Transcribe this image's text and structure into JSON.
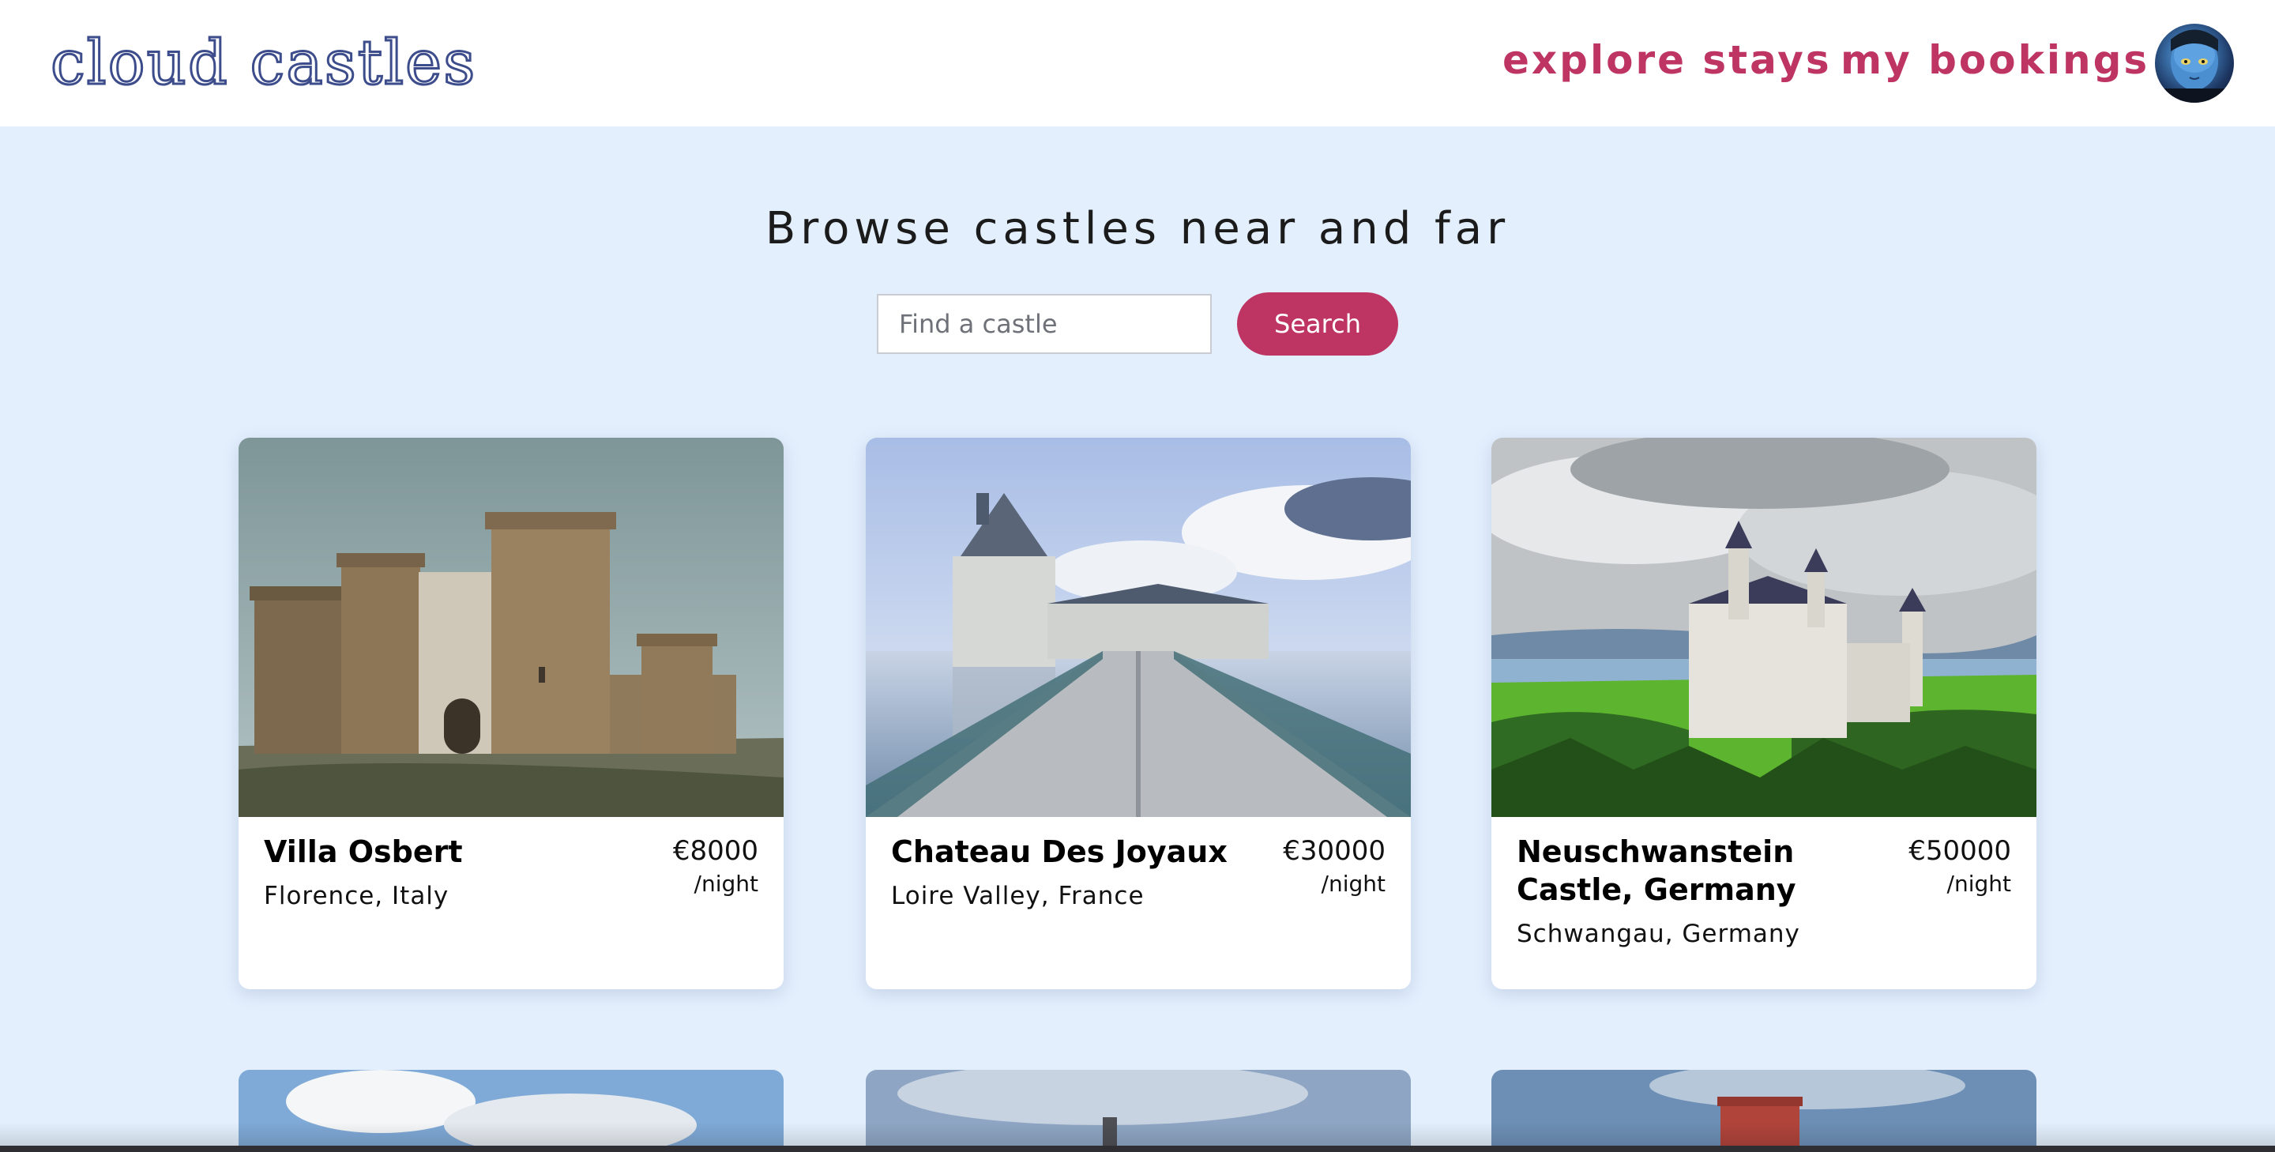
{
  "header": {
    "logo": "cloud castles",
    "nav": {
      "explore": "explore stays",
      "bookings": "my bookings"
    },
    "avatar_icon": "user-avatar-icon"
  },
  "hero": {
    "title": "Browse castles near and far",
    "search": {
      "placeholder": "Find a castle",
      "value": "",
      "button_label": "Search"
    }
  },
  "listings": [
    {
      "name": "Villa Osbert",
      "location": "Florence, Italy",
      "price": "€8000",
      "per": "/night"
    },
    {
      "name": "Chateau Des Joyaux",
      "location": "Loire Valley, France",
      "price": "€30000",
      "per": "/night"
    },
    {
      "name": "Neuschwanstein Castle, Germany",
      "location": "Schwangau, Germany",
      "price": "€50000",
      "per": "/night"
    }
  ],
  "colors": {
    "accent": "#be3563",
    "logo": "#3d4d8c",
    "background": "#e3effd",
    "card": "#ffffff"
  }
}
